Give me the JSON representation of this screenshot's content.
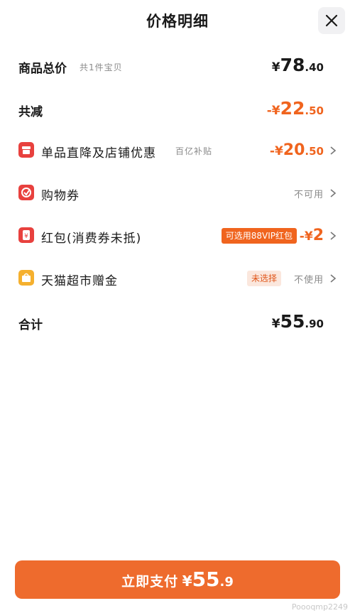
{
  "header": {
    "title": "价格明细"
  },
  "summary": {
    "goods_total_label": "商品总价",
    "goods_total_sub": "共1件宝贝",
    "goods_total_currency": "¥",
    "goods_total_int": "78",
    "goods_total_dec": ".40",
    "reduced_label": "共减",
    "reduced_sign": "-¥",
    "reduced_int": "22",
    "reduced_dec": ".50"
  },
  "items": [
    {
      "icon": "store-discount-icon",
      "label": "单品直降及店铺优惠",
      "sub": "百亿补贴",
      "value_sign": "-¥",
      "value_int": "20",
      "value_dec": ".50",
      "icon_color": "#e8413e"
    },
    {
      "icon": "coupon-icon",
      "label": "购物券",
      "status": "不可用",
      "icon_color": "#e8413e"
    },
    {
      "icon": "red-packet-icon",
      "label": "红包(消费券未抵)",
      "tag": "可选用88VIP红包",
      "value_sign": "-¥",
      "value_int": "2",
      "icon_color": "#e8413e"
    },
    {
      "icon": "gift-bag-icon",
      "label": "天猫超市赠金",
      "tag": "未选择",
      "status": "不使用",
      "icon_color": "#f5b02e"
    }
  ],
  "total": {
    "label": "合计",
    "currency": "¥",
    "int": "55",
    "dec": ".90"
  },
  "pay_button": {
    "label": "立即支付",
    "currency": "¥",
    "int": "55",
    "dec": ".9"
  },
  "watermark": "Poooqmp2249",
  "colors": {
    "accent": "#f0641e",
    "button": "#ee6b2d"
  }
}
